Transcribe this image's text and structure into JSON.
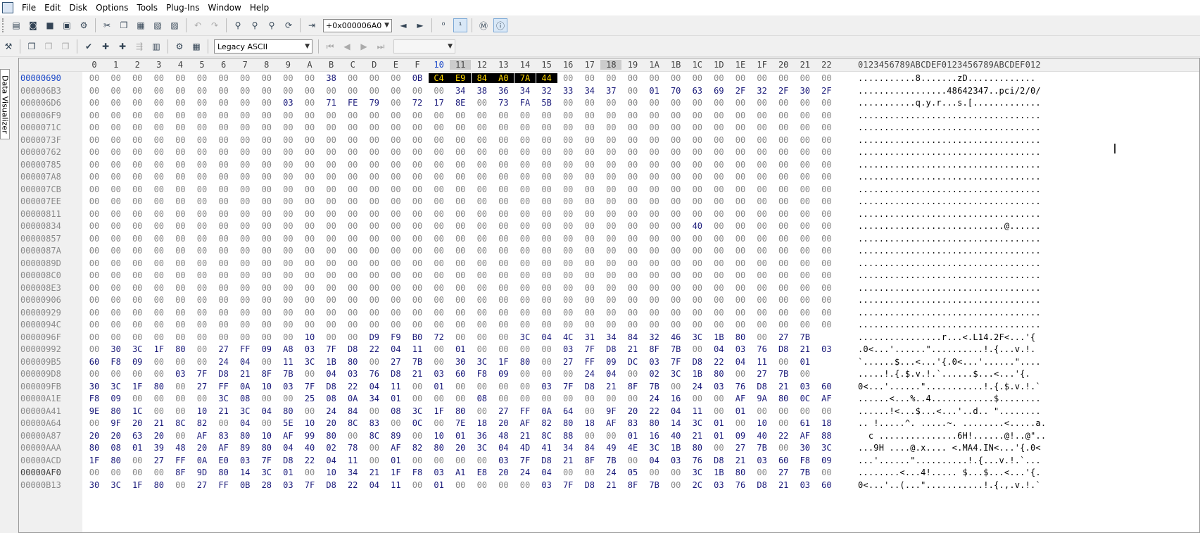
{
  "menu": [
    "File",
    "Edit",
    "Disk",
    "Options",
    "Tools",
    "Plug-Ins",
    "Window",
    "Help"
  ],
  "toolbar1": {
    "offset_value": "+0x000006A0"
  },
  "toolbar2": {
    "charset": "Legacy ASCII"
  },
  "side_panel": {
    "label": "Data Visualizer"
  },
  "columns": [
    "0",
    "1",
    "2",
    "3",
    "4",
    "5",
    "6",
    "7",
    "8",
    "9",
    "A",
    "B",
    "C",
    "D",
    "E",
    "F",
    "10",
    "11",
    "12",
    "13",
    "14",
    "15",
    "16",
    "17",
    "18",
    "19",
    "1A",
    "1B",
    "1C",
    "1D",
    "1E",
    "1F",
    "20",
    "21",
    "22"
  ],
  "ascii_header": "0123456789ABCDEF0123456789ABCDEF012",
  "rows": [
    {
      "off": "00000690",
      "hex": "00 00 00 00 00 00 00 00 00 00 00 38 00 00 00 0B C4 E9 84 A0 7A 44 00 00 00 00 00 00 00 00 00 00 00 00 00",
      "ascii": "...........8.......zD............."
    },
    {
      "off": "000006B3",
      "hex": "00 00 00 00 00 00 00 00 00 00 00 00 00 00 00 00 00 34 38 36 34 32 33 34 37 00 01 70 63 69 2F 32 2F 30 2F",
      "ascii": ".................48642347..pci/2/0/"
    },
    {
      "off": "000006D6",
      "hex": "00 00 00 00 00 00 00 00 00 03 00 71 FE 79 00 72 17 8E 00 73 FA 5B 00 00 00 00 00 00 00 00 00 00 00 00 00",
      "ascii": "...........q.y.r...s.[............."
    },
    {
      "off": "000006F9",
      "hex": "00 00 00 00 00 00 00 00 00 00 00 00 00 00 00 00 00 00 00 00 00 00 00 00 00 00 00 00 00 00 00 00 00 00 00",
      "ascii": "..................................."
    },
    {
      "off": "0000071C",
      "hex": "00 00 00 00 00 00 00 00 00 00 00 00 00 00 00 00 00 00 00 00 00 00 00 00 00 00 00 00 00 00 00 00 00 00 00",
      "ascii": "..................................."
    },
    {
      "off": "0000073F",
      "hex": "00 00 00 00 00 00 00 00 00 00 00 00 00 00 00 00 00 00 00 00 00 00 00 00 00 00 00 00 00 00 00 00 00 00 00",
      "ascii": "..................................."
    },
    {
      "off": "00000762",
      "hex": "00 00 00 00 00 00 00 00 00 00 00 00 00 00 00 00 00 00 00 00 00 00 00 00 00 00 00 00 00 00 00 00 00 00 00",
      "ascii": "..................................."
    },
    {
      "off": "00000785",
      "hex": "00 00 00 00 00 00 00 00 00 00 00 00 00 00 00 00 00 00 00 00 00 00 00 00 00 00 00 00 00 00 00 00 00 00 00",
      "ascii": "..................................."
    },
    {
      "off": "000007A8",
      "hex": "00 00 00 00 00 00 00 00 00 00 00 00 00 00 00 00 00 00 00 00 00 00 00 00 00 00 00 00 00 00 00 00 00 00 00",
      "ascii": "..................................."
    },
    {
      "off": "000007CB",
      "hex": "00 00 00 00 00 00 00 00 00 00 00 00 00 00 00 00 00 00 00 00 00 00 00 00 00 00 00 00 00 00 00 00 00 00 00",
      "ascii": "..................................."
    },
    {
      "off": "000007EE",
      "hex": "00 00 00 00 00 00 00 00 00 00 00 00 00 00 00 00 00 00 00 00 00 00 00 00 00 00 00 00 00 00 00 00 00 00 00",
      "ascii": "..................................."
    },
    {
      "off": "00000811",
      "hex": "00 00 00 00 00 00 00 00 00 00 00 00 00 00 00 00 00 00 00 00 00 00 00 00 00 00 00 00 00 00 00 00 00 00 00",
      "ascii": "..................................."
    },
    {
      "off": "00000834",
      "hex": "00 00 00 00 00 00 00 00 00 00 00 00 00 00 00 00 00 00 00 00 00 00 00 00 00 00 00 00 40 00 00 00 00 00 00",
      "ascii": "............................@......"
    },
    {
      "off": "00000857",
      "hex": "00 00 00 00 00 00 00 00 00 00 00 00 00 00 00 00 00 00 00 00 00 00 00 00 00 00 00 00 00 00 00 00 00 00 00",
      "ascii": "..................................."
    },
    {
      "off": "0000087A",
      "hex": "00 00 00 00 00 00 00 00 00 00 00 00 00 00 00 00 00 00 00 00 00 00 00 00 00 00 00 00 00 00 00 00 00 00 00",
      "ascii": "..................................."
    },
    {
      "off": "0000089D",
      "hex": "00 00 00 00 00 00 00 00 00 00 00 00 00 00 00 00 00 00 00 00 00 00 00 00 00 00 00 00 00 00 00 00 00 00 00",
      "ascii": "..................................."
    },
    {
      "off": "000008C0",
      "hex": "00 00 00 00 00 00 00 00 00 00 00 00 00 00 00 00 00 00 00 00 00 00 00 00 00 00 00 00 00 00 00 00 00 00 00",
      "ascii": "..................................."
    },
    {
      "off": "000008E3",
      "hex": "00 00 00 00 00 00 00 00 00 00 00 00 00 00 00 00 00 00 00 00 00 00 00 00 00 00 00 00 00 00 00 00 00 00 00",
      "ascii": "..................................."
    },
    {
      "off": "00000906",
      "hex": "00 00 00 00 00 00 00 00 00 00 00 00 00 00 00 00 00 00 00 00 00 00 00 00 00 00 00 00 00 00 00 00 00 00 00",
      "ascii": "..................................."
    },
    {
      "off": "00000929",
      "hex": "00 00 00 00 00 00 00 00 00 00 00 00 00 00 00 00 00 00 00 00 00 00 00 00 00 00 00 00 00 00 00 00 00 00 00",
      "ascii": "..................................."
    },
    {
      "off": "0000094C",
      "hex": "00 00 00 00 00 00 00 00 00 00 00 00 00 00 00 00 00 00 00 00 00 00 00 00 00 00 00 00 00 00 00 00 00 00 00",
      "ascii": "..................................."
    },
    {
      "off": "0000096F",
      "hex": "00 00 00 00 00 00 00 00 00 00 10 00 00 D9 F9 B0 72 00 00 00 3C 04 4C 31 34 84 32 46 3C 1B 80 00 27 7B",
      "ascii": "................r...<.L14.2F<...'{"
    },
    {
      "off": "00000992",
      "hex": "00 30 3C 1F 80 00 27 FF 09 A8 03 7F D8 22 04 11 00 01 00 00 00 00 03 7F D8 21 8F 7B 00 04 03 76 D8 21 03",
      "ascii": ".0<...'......\"..........!.{...v.!."
    },
    {
      "off": "000009B5",
      "hex": "60 F8 09 00 00 00 24 04 00 11 3C 1B 80 00 27 7B 00 30 3C 1F 80 00 27 FF 09 DC 03 7F D8 22 04 11 00 01",
      "ascii": "`......$...<...'{.0<...'......\"...."
    },
    {
      "off": "000009D8",
      "hex": "00 00 00 00 03 7F D8 21 8F 7B 00 04 03 76 D8 21 03 60 F8 09 00 00 00 24 04 00 02 3C 1B 80 00 27 7B 00",
      "ascii": ".....!.{.$.v.!.`......$...<...'{."
    },
    {
      "off": "000009FB",
      "hex": "30 3C 1F 80 00 27 FF 0A 10 03 7F D8 22 04 11 00 01 00 00 00 00 03 7F D8 21 8F 7B 00 24 03 76 D8 21 03 60",
      "ascii": "0<...'......\"...........!.{.$.v.!.`"
    },
    {
      "off": "00000A1E",
      "hex": "F8 09 00 00 00 00 3C 08 00 00 25 08 0A 34 01 00 00 00 08 00 00 00 00 00 00 00 24 16 00 00 AF 9A 80 0C AF",
      "ascii": "......<...%..4............$........"
    },
    {
      "off": "00000A41",
      "hex": "9E 80 1C 00 00 10 21 3C 04 80 00 24 84 00 08 3C 1F 80 00 27 FF 0A 64 00 9F 20 22 04 11 00 01 00 00 00 00",
      "ascii": "......!<...$...<...'..d.. \"........"
    },
    {
      "off": "00000A64",
      "hex": "00 9F 20 21 8C 82 00 04 00 5E 10 20 8C 83 00 0C 00 7E 18 20 AF 82 80 18 AF 83 80 14 3C 01 00 10 00 61 18",
      "ascii": ".. !.....^. .....~. ........<.....a."
    },
    {
      "off": "00000A87",
      "hex": "20 20 63 20 00 AF 83 80 10 AF 99 80 00 8C 89 00 10 01 36 48 21 8C 88 00 00 01 16 40 21 01 09 40 22 AF 88",
      "ascii": "  c ...............6H!......@!..@\".."
    },
    {
      "off": "00000AAA",
      "hex": "80 08 01 39 48 20 AF 89 80 04 40 02 78 00 AF 82 80 20 3C 04 4D 41 34 84 49 4E 3C 1B 80 00 27 7B 00 30 3C",
      "ascii": "...9H ....@.x.... <.MA4.IN<...'{.0<"
    },
    {
      "off": "00000ACD",
      "hex": "1F 80 00 27 FF 0A E0 03 7F D8 22 04 11 00 01 00 00 00 00 03 7F D8 21 8F 7B 00 04 03 76 D8 21 03 60 F8 09",
      "ascii": "...'......\"..........!.{...v.!.`..."
    },
    {
      "off": "00000AF0",
      "hex": "00 00 00 00 8F 9D 80 14 3C 01 00 10 34 21 1F F8 03 A1 E8 20 24 04 00 00 24 05 00 00 3C 1B 80 00 27 7B 00",
      "ascii": "........<...4!..... $...$...<...'{."
    },
    {
      "off": "00000B13",
      "hex": "30 3C 1F 80 00 27 FF 0B 28 03 7F D8 22 04 11 00 01 00 00 00 00 03 7F D8 21 8F 7B 00 2C 03 76 D8 21 03 60",
      "ascii": "0<...'..(...\"...........!.{.,.v.!.`"
    }
  ]
}
